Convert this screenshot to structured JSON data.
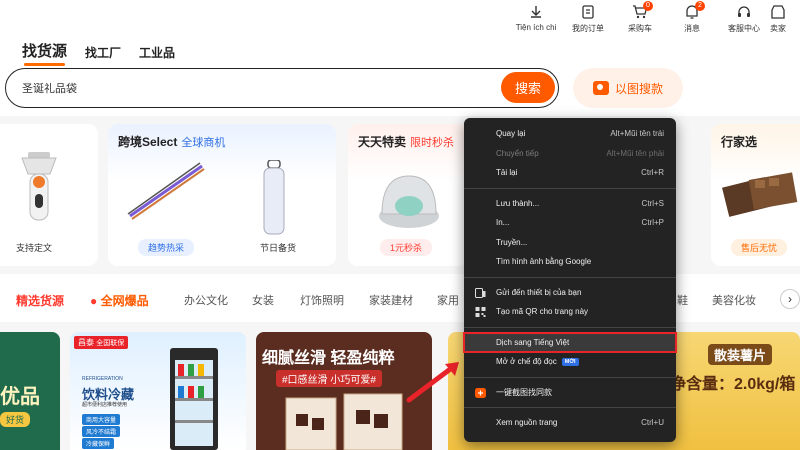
{
  "topbar": [
    {
      "label": "Tiện ích chi",
      "icon": "download-icon",
      "badge": ""
    },
    {
      "label": "我的订单",
      "icon": "order-icon",
      "badge": ""
    },
    {
      "label": "采购车",
      "icon": "cart-icon",
      "badge": "0"
    },
    {
      "label": "消息",
      "icon": "message-icon",
      "badge": "2"
    },
    {
      "label": "客服中心",
      "icon": "headset-icon",
      "badge": ""
    },
    {
      "label": "卖家",
      "icon": "seller-icon",
      "badge": ""
    }
  ],
  "nav": {
    "tab1": "找货源",
    "tab2": "找工厂",
    "tab3": "工业品"
  },
  "search": {
    "value": "圣诞礼品袋",
    "button": "搜索",
    "image_search": "以图搜款"
  },
  "cards": {
    "c1_caption": "支持定文",
    "c2_title": "跨境Select",
    "c2_sub": "全球商机",
    "c2_tag1": "趋势热采",
    "c2_tag2": "节日备货",
    "c3_title": "天天特卖",
    "c3_sub": "限时秒杀",
    "c3_tag": "1元秒杀",
    "c4_title": "行家选",
    "c4_tag": "售后无忧"
  },
  "categories": [
    "精选货源",
    "全网爆品",
    "办公文化",
    "女装",
    "灯饰照明",
    "家装建材",
    "家用",
    "鞋",
    "美容化妆"
  ],
  "products": {
    "p1_text": "优品",
    "p1_sub": "好货",
    "p2_brand": "昌泰",
    "p2_tag": "全国联保",
    "p2_en": "REFRIGERATION",
    "p2_title": "饮料冷藏",
    "p2_sub": "超市便利店推荐使用",
    "p2_f1": "商用大容量",
    "p2_f2": "风冷不结霜",
    "p2_f3": "冷藏保鲜",
    "p3_title": "细腻丝滑 轻盈纯粹",
    "p3_sub": "#口感丝滑 小巧可爱#",
    "p4_title": "散装薯片",
    "p4_sub": "净含量：2.0kg/箱"
  },
  "context_menu": {
    "items": [
      {
        "label": "Quay lại",
        "shortcut": "Alt+Mũi tên trái",
        "disabled": false
      },
      {
        "label": "Chuyển tiếp",
        "shortcut": "Alt+Mũi tên phải",
        "disabled": true
      },
      {
        "label": "Tải lại",
        "shortcut": "Ctrl+R",
        "disabled": false
      },
      {
        "label": "Lưu thành...",
        "shortcut": "Ctrl+S",
        "disabled": false
      },
      {
        "label": "In...",
        "shortcut": "Ctrl+P",
        "disabled": false
      },
      {
        "label": "Truyền...",
        "shortcut": "",
        "disabled": false
      },
      {
        "label": "Tìm hình ảnh bằng Google",
        "shortcut": "",
        "disabled": false
      },
      {
        "label": "Gửi đến thiết bị của bạn",
        "shortcut": "",
        "disabled": false
      },
      {
        "label": "Tạo mã QR cho trang này",
        "shortcut": "",
        "disabled": false
      },
      {
        "label": "Dịch sang Tiếng Việt",
        "shortcut": "",
        "disabled": false
      },
      {
        "label": "Mở ở chế độ đọc",
        "shortcut": "",
        "disabled": false,
        "badge": "MỚI"
      },
      {
        "label": "一键截图找同款",
        "shortcut": "",
        "disabled": false
      },
      {
        "label": "Xem nguồn trang",
        "shortcut": "Ctrl+U",
        "disabled": false
      }
    ]
  },
  "colors": {
    "accent": "#ff5a00",
    "menu_bg": "#232323",
    "highlight_border": "#e8232a",
    "link_blue": "#2f6fe4"
  }
}
